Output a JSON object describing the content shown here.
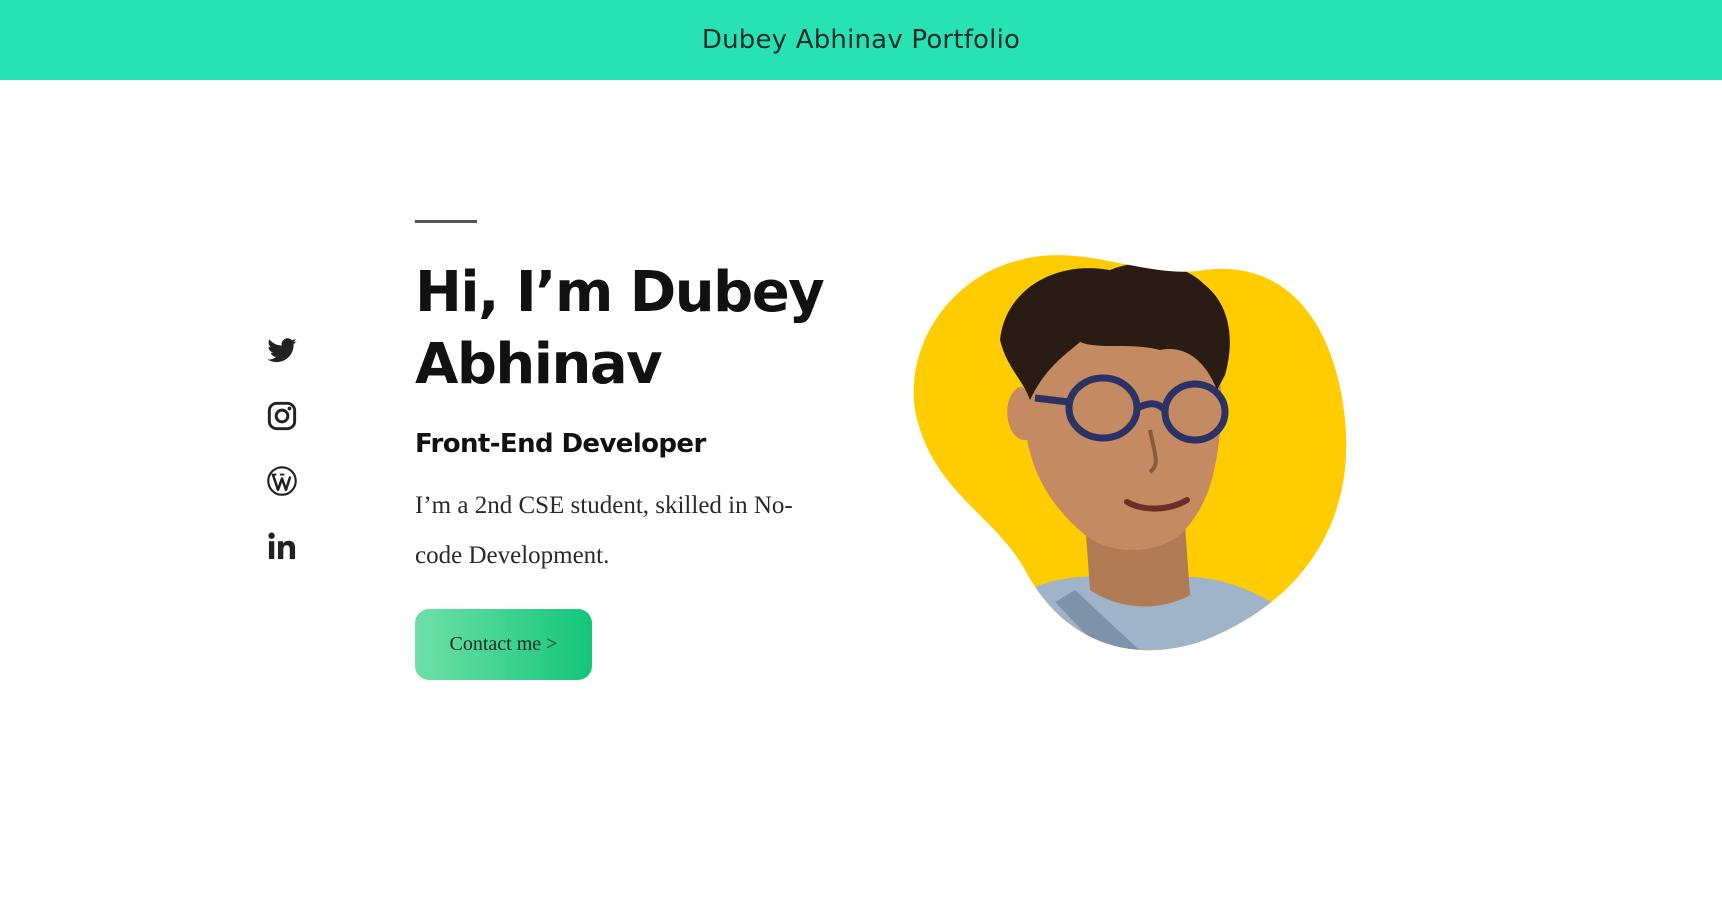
{
  "header": {
    "title": "Dubey Abhinav Portfolio"
  },
  "social": [
    {
      "icon": "twitter-icon"
    },
    {
      "icon": "instagram-icon"
    },
    {
      "icon": "wordpress-icon"
    },
    {
      "icon": "linkedin-icon"
    }
  ],
  "hero": {
    "heading": "Hi, I’m Dubey Abhinav",
    "role": "Front-End Developer",
    "description": "I’m a 2nd CSE student, skilled in No-code Development.",
    "button_label": "Contact me >"
  },
  "colors": {
    "header_bg": "#27e3b4",
    "blob": "#ffcc00",
    "button_start": "#6ee0a8",
    "button_end": "#12c67a"
  }
}
